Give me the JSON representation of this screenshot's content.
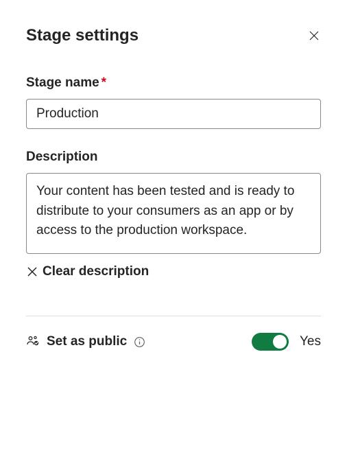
{
  "header": {
    "title": "Stage settings"
  },
  "stageName": {
    "label": "Stage name",
    "required": "*",
    "value": "Production"
  },
  "description": {
    "label": "Description",
    "value": "Your content has been tested and is ready to distribute to your consumers as an app or by access to the production workspace.",
    "clearLabel": "Clear description"
  },
  "public": {
    "label": "Set as public",
    "toggleState": "Yes"
  },
  "colors": {
    "toggleOn": "#107c41"
  }
}
